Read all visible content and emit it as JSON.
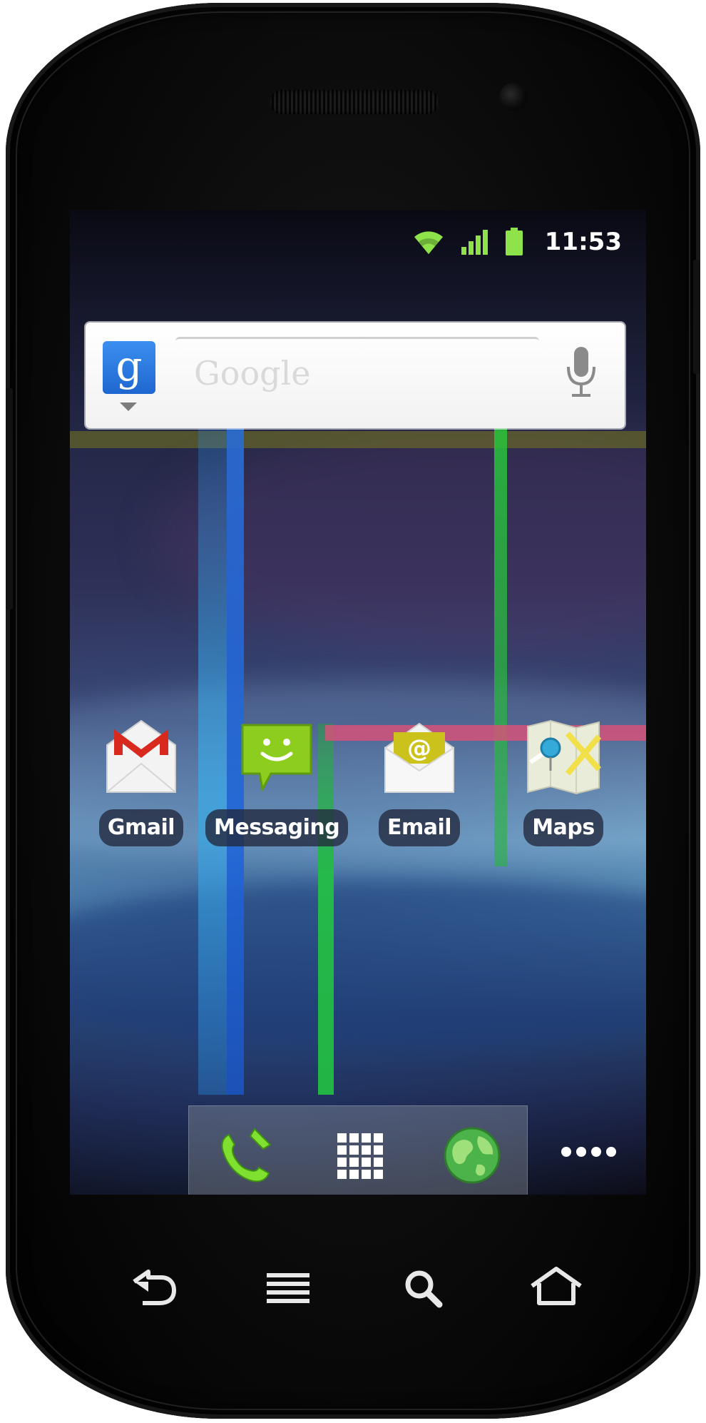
{
  "status_bar": {
    "time": "11:53",
    "icons": [
      "wifi-icon",
      "signal-icon",
      "battery-icon"
    ],
    "icon_color": "#8ee34a"
  },
  "search_widget": {
    "placeholder": "Google",
    "logo_letter": "g",
    "icons": [
      "google-g-icon",
      "microphone-icon"
    ]
  },
  "apps": [
    {
      "label": "Gmail",
      "icon": "gmail-icon"
    },
    {
      "label": "Messaging",
      "icon": "messaging-icon"
    },
    {
      "label": "Email",
      "icon": "email-icon"
    },
    {
      "label": "Maps",
      "icon": "maps-icon"
    }
  ],
  "dock": {
    "buttons": [
      "phone-icon",
      "app-drawer-icon",
      "browser-icon"
    ],
    "more": "more-dots-icon"
  },
  "hardware_buttons": [
    "back-icon",
    "menu-icon",
    "search-icon",
    "home-icon"
  ],
  "colors": {
    "accent_green": "#8ee34a",
    "google_blue": "#2a7ae2",
    "label_bg": "#23283c"
  }
}
